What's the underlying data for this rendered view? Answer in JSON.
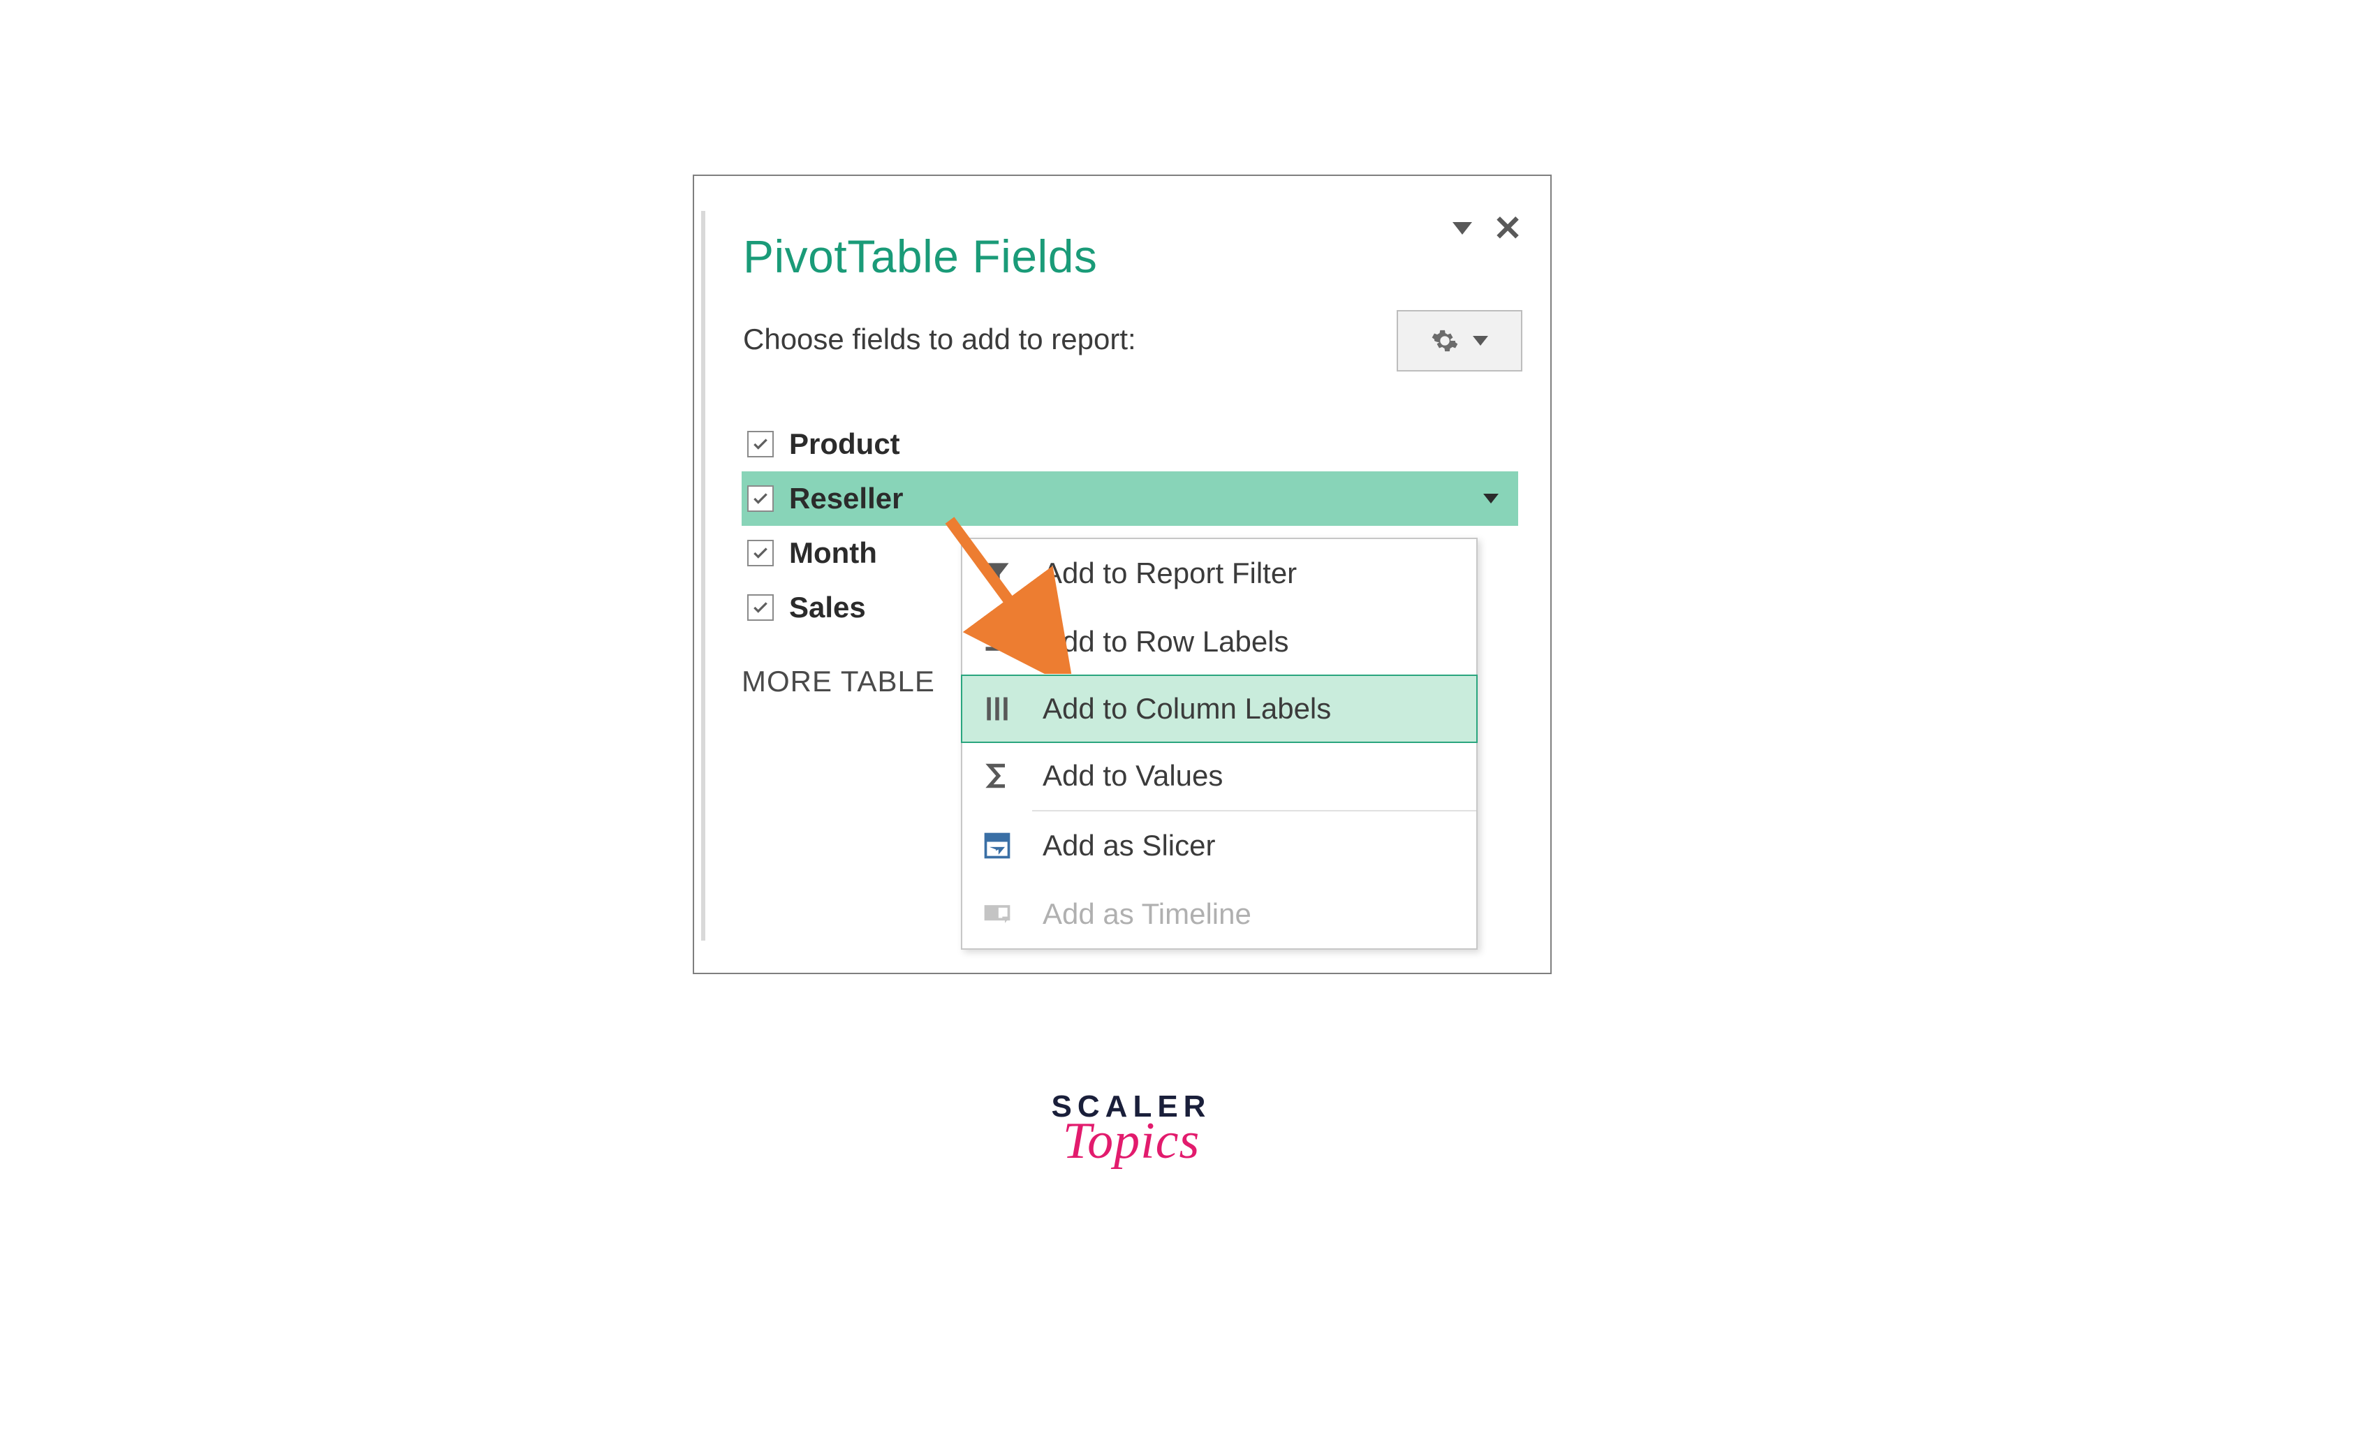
{
  "panel": {
    "title": "PivotTable Fields",
    "subtitle": "Choose fields to add to report:",
    "more_tables": "MORE TABLE",
    "fields": [
      {
        "label": "Product",
        "checked": true,
        "selected": false
      },
      {
        "label": "Reseller",
        "checked": true,
        "selected": true
      },
      {
        "label": "Month",
        "checked": true,
        "selected": false
      },
      {
        "label": "Sales",
        "checked": true,
        "selected": false
      }
    ]
  },
  "context_menu": {
    "items": [
      {
        "label": "Add to Report Filter",
        "icon": "funnel-icon",
        "highlighted": false,
        "disabled": false
      },
      {
        "label": "Add to Row Labels",
        "icon": "row-labels-icon",
        "highlighted": false,
        "disabled": false
      },
      {
        "label": "Add to Column Labels",
        "icon": "column-labels-icon",
        "highlighted": true,
        "disabled": false
      },
      {
        "label": "Add to Values",
        "icon": "sigma-icon",
        "highlighted": false,
        "disabled": false
      },
      {
        "label": "Add as Slicer",
        "icon": "slicer-icon",
        "highlighted": false,
        "disabled": false
      },
      {
        "label": "Add as Timeline",
        "icon": "timeline-icon",
        "highlighted": false,
        "disabled": true
      }
    ]
  },
  "logo": {
    "line1": "SCALER",
    "line2": "Topics"
  },
  "colors": {
    "accent": "#1a9b78",
    "selection": "#88d4b8",
    "menu_highlight": "#c9ecdc",
    "arrow": "#ed7d31",
    "logo_pink": "#e21b6d"
  }
}
